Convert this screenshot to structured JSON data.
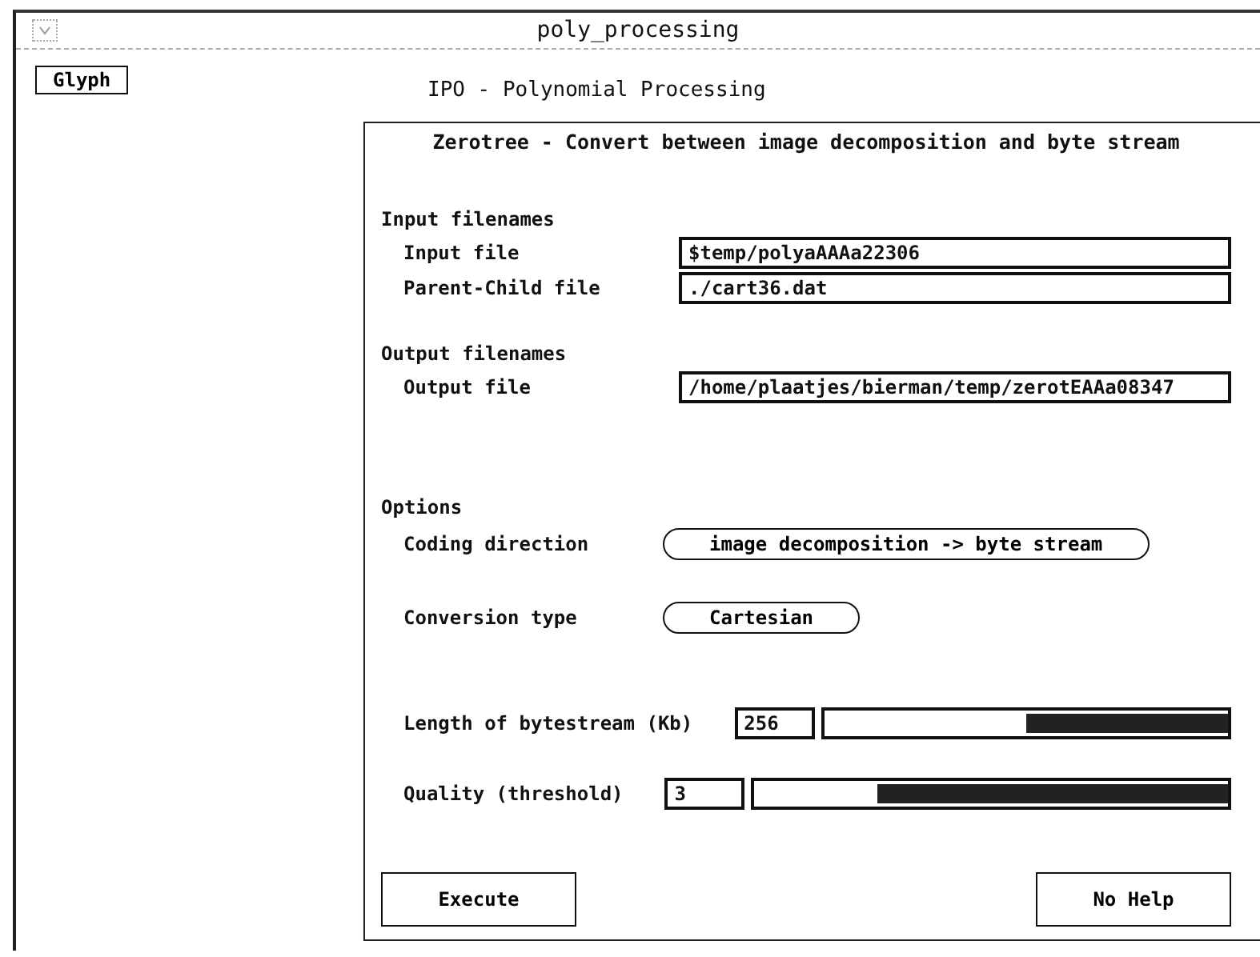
{
  "window": {
    "title": "poly_processing"
  },
  "glyph_button": "Glyph",
  "app_title": "IPO - Polynomial Processing",
  "panel": {
    "title": "Zerotree - Convert between image decomposition and byte stream",
    "sections": [
      {
        "heading": "Input filenames",
        "fields": [
          {
            "label": "Input file",
            "value": "$temp/polyaAAAa22306"
          },
          {
            "label": "Parent-Child file",
            "value": "./cart36.dat"
          }
        ]
      },
      {
        "heading": "Output filenames",
        "fields": [
          {
            "label": "Output file",
            "value": "/home/plaatjes/bierman/temp/zerotEAAa08347"
          }
        ]
      }
    ],
    "options": {
      "heading": "Options",
      "choices": [
        {
          "label": "Coding direction",
          "value": "image decomposition -> byte stream"
        },
        {
          "label": "Conversion type",
          "value": "Cartesian"
        }
      ],
      "sliders": [
        {
          "label": "Length of bytestream (Kb)",
          "value": "256",
          "level": 0.5
        },
        {
          "label": "Quality (threshold)",
          "value": "3",
          "level": 0.74
        }
      ]
    },
    "buttons": [
      "Execute",
      "No Help"
    ]
  }
}
